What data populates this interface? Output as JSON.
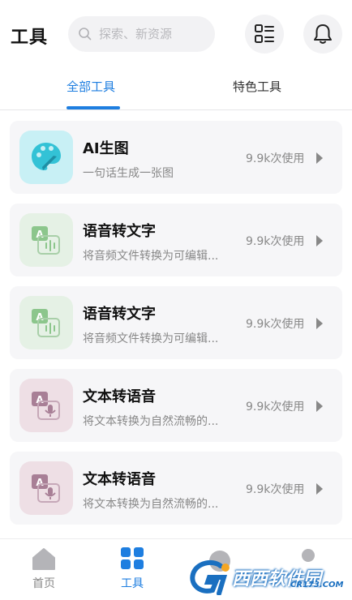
{
  "header": {
    "title": "工具",
    "search_placeholder": "探索、新资源",
    "list_icon": "list-icon",
    "bell_icon": "bell-icon"
  },
  "tabs": [
    {
      "label": "全部工具",
      "active": true
    },
    {
      "label": "特色工具",
      "active": false
    }
  ],
  "tools": [
    {
      "title": "AI生图",
      "desc": "一句话生成一张图",
      "usage": "9.9k次使用",
      "icon": "palette-icon"
    },
    {
      "title": "语音转文字",
      "desc": "将音频文件转换为可编辑...",
      "usage": "9.9k次使用",
      "icon": "speech-to-text-icon"
    },
    {
      "title": "语音转文字",
      "desc": "将音频文件转换为可编辑...",
      "usage": "9.9k次使用",
      "icon": "speech-to-text-icon"
    },
    {
      "title": "文本转语音",
      "desc": "将文本转换为自然流畅的...",
      "usage": "9.9k次使用",
      "icon": "text-to-speech-icon"
    },
    {
      "title": "文本转语音",
      "desc": "将文本转换为自然流畅的...",
      "usage": "9.9k次使用",
      "icon": "text-to-speech-icon"
    }
  ],
  "bottom_nav": [
    {
      "label": "首页",
      "icon": "home-icon",
      "active": false
    },
    {
      "label": "工具",
      "icon": "grid-icon",
      "active": true
    }
  ],
  "watermark": {
    "text": "西西软件园",
    "sub": "CR173.COM"
  },
  "colors": {
    "accent": "#1e7ee0",
    "card_bg": "#f6f6f8"
  }
}
